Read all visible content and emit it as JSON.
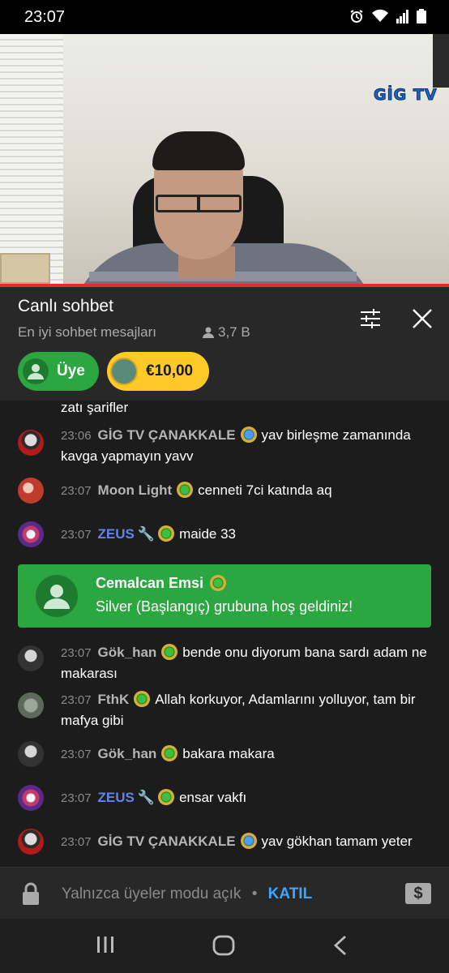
{
  "status_bar": {
    "time": "23:07"
  },
  "video": {
    "logo_text": "GİG TV"
  },
  "chat_header": {
    "title": "Canlı sohbet",
    "subtitle": "En iyi sohbet mesajları",
    "viewers": "3,7 B",
    "ticker": [
      {
        "label": "Üye",
        "color": "#2ba640"
      },
      {
        "label": "€10,00",
        "color": "#ffca28"
      }
    ]
  },
  "messages": [
    {
      "time": "",
      "author": "",
      "text": "zatı şarifler"
    },
    {
      "time": "23:06",
      "author": "GİG TV ÇANAKKALE",
      "text": "yav birleşme zamanında kavga yapmayın yavv"
    },
    {
      "time": "23:07",
      "author": "Moon Light",
      "text": "cenneti 7ci katında aq"
    },
    {
      "time": "23:07",
      "author": "ZEUS",
      "text": "maide 33"
    },
    {
      "time": "23:07",
      "author": "Gök_han",
      "text": "bende onu diyorum bana sardı adam ne makarası"
    },
    {
      "time": "23:07",
      "author": "FthK",
      "text": "Allah korkuyor, Adamlarını yolluyor, tam bir mafya gibi"
    },
    {
      "time": "23:07",
      "author": "Gök_han",
      "text": "bakara makara"
    },
    {
      "time": "23:07",
      "author": "ZEUS",
      "text": "ensar vakfı"
    },
    {
      "time": "23:07",
      "author": "GİG TV ÇANAKKALE",
      "text": "yav gökhan tamam yeter"
    }
  ],
  "membership": {
    "author": "Cemalcan Emsi",
    "text": "Silver (Başlangıç) grubuna hoş geldiniz!",
    "color": "#2ba640"
  },
  "input_bar": {
    "placeholder": "Yalnızca üyeler modu açık",
    "separator": "•",
    "join_label": "KATIL"
  },
  "icons": [
    "alarm-icon",
    "wifi-icon",
    "signal-icon",
    "battery-icon",
    "person-icon",
    "filter-icon",
    "close-icon",
    "lock-icon",
    "dollar-icon",
    "recents-icon",
    "home-icon",
    "back-icon"
  ]
}
